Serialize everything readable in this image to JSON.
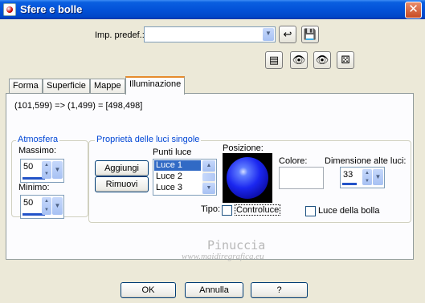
{
  "window": {
    "title": "Sfere e bolle",
    "close_glyph": "✕"
  },
  "preset": {
    "label": "Imp. predef.:",
    "value": ""
  },
  "tabs": [
    {
      "label": "Forma"
    },
    {
      "label": "Superficie"
    },
    {
      "label": "Mappe"
    },
    {
      "label": "Illuminazione"
    }
  ],
  "mapping_text": "(101,599) => (1,499) = [498,498]",
  "atmosfera": {
    "title": "Atmosfera",
    "max_label": "Massimo:",
    "max_value": "50",
    "max_level": 0.5,
    "min_label": "Minimo:",
    "min_value": "50",
    "min_level": 0.5
  },
  "luci": {
    "title": "Proprietà delle luci singole",
    "points_label": "Punti luce",
    "add_label": "Aggiungi",
    "remove_label": "Rimuovi",
    "items": [
      "Luce 1",
      "Luce 2",
      "Luce 3"
    ],
    "selected_index": 0,
    "position_label": "Posizione:",
    "color_label": "Colore:",
    "size_label": "Dimensione alte luci:",
    "size_value": "33",
    "size_level": 0.33,
    "type_label": "Tipo:",
    "controluce_label": "Controluce",
    "bubble_light_label": "Luce della bolla"
  },
  "watermark": {
    "name": "Pinuccia",
    "site": "www.maidiregrafica.eu"
  },
  "footer": {
    "ok": "OK",
    "cancel": "Annulla",
    "help": "?"
  },
  "colors": {
    "title_bar": "#0352d8",
    "tab_accent": "#e68b2c",
    "group_title": "#0046d5",
    "selection": "#316ac5"
  }
}
